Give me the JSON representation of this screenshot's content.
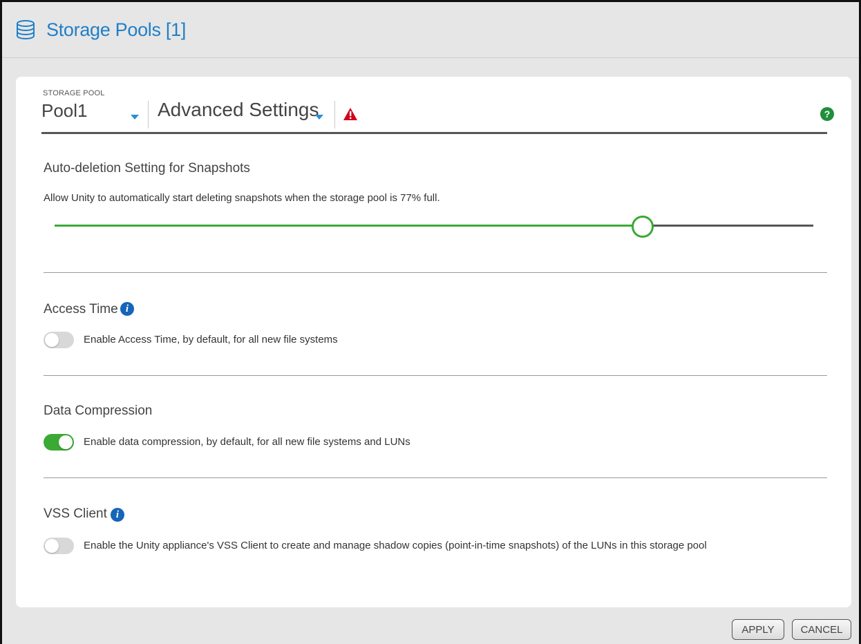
{
  "window": {
    "title": "Storage Pools [1]",
    "title_icon": "database-icon"
  },
  "header": {
    "pool_label": "STORAGE POOL",
    "pool_value": "Pool1",
    "view_value": "Advanced Settings",
    "warning_icon": "warning-triangle-icon",
    "help_icon": "help-circle-icon",
    "help_glyph": "?"
  },
  "auto_deletion": {
    "title": "Auto-deletion Setting for Snapshots",
    "description": "Allow Unity to automatically start deleting snapshots when the storage pool is 77% full.",
    "slider_value_percent": 77
  },
  "access_time": {
    "title": "Access Time",
    "info_glyph": "i",
    "toggle_on": false,
    "toggle_label": "Enable Access Time, by default, for all new file systems"
  },
  "data_compression": {
    "title": "Data Compression",
    "toggle_on": true,
    "toggle_label": "Enable data compression, by default, for all new file systems and LUNs"
  },
  "vss_client": {
    "title": "VSS Client",
    "info_glyph": "i",
    "toggle_on": false,
    "toggle_label": "Enable the Unity appliance's VSS Client to create and manage shadow copies (point-in-time snapshots) of the LUNs in this storage pool"
  },
  "footer": {
    "apply_label": "APPLY",
    "cancel_label": "CANCEL"
  },
  "colors": {
    "accent_blue": "#1f7fc8",
    "toggle_on_green": "#3aaa35",
    "warning_red": "#d0021b",
    "help_green": "#1f8f3a",
    "info_blue": "#1565b8"
  }
}
